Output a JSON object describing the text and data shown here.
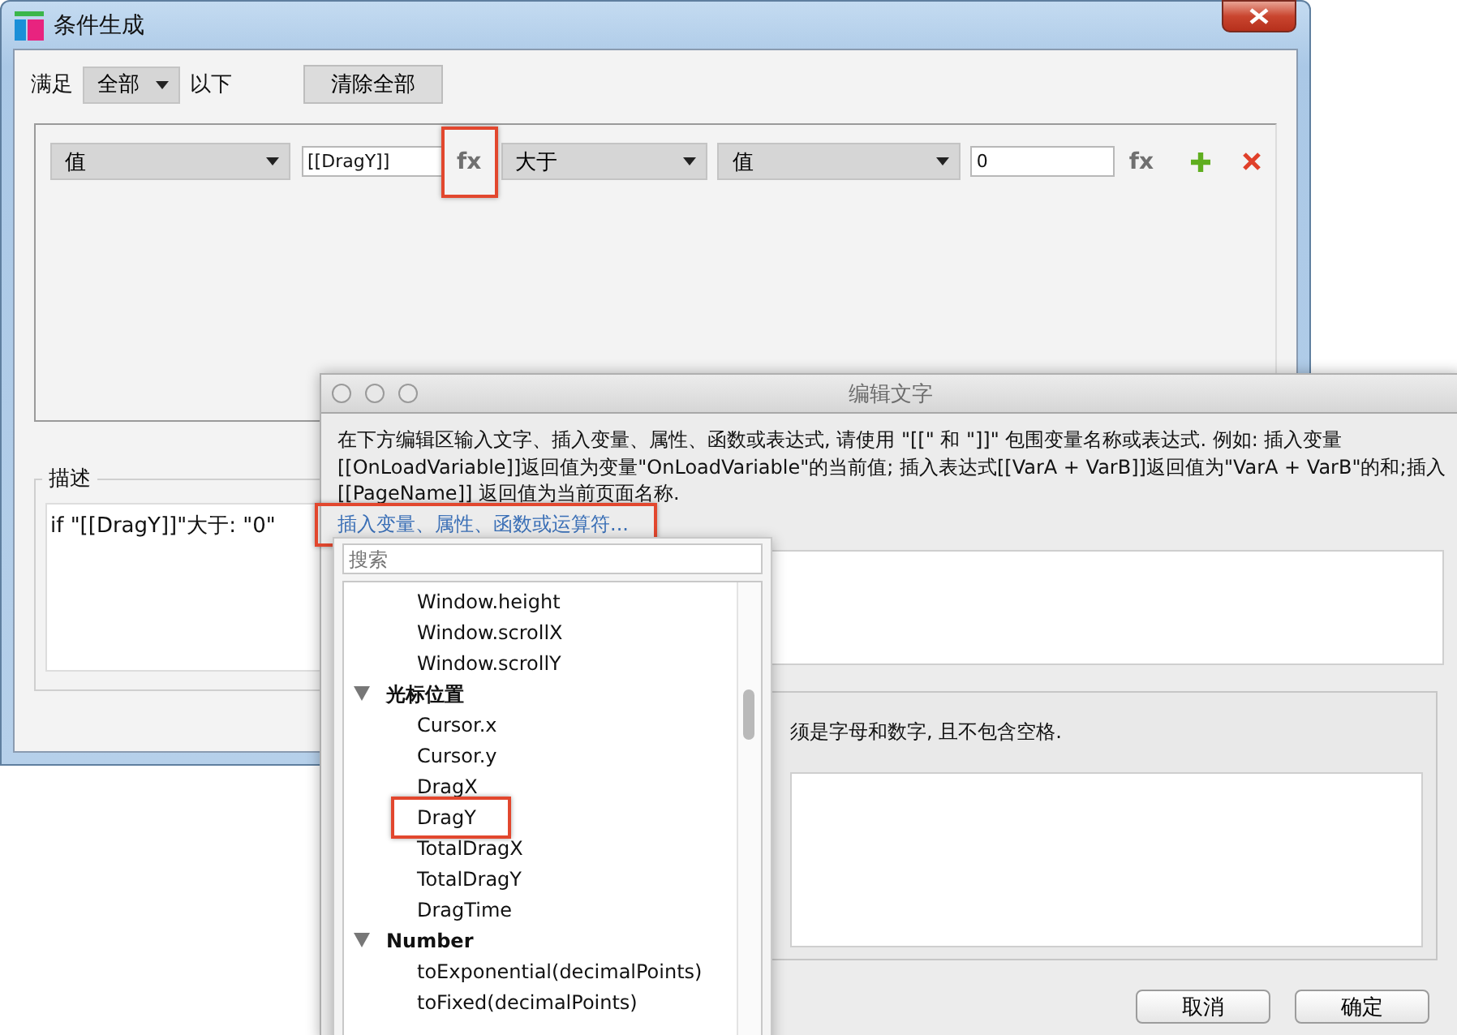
{
  "condition_window": {
    "title": "条件生成",
    "match_label": "满足",
    "match_select": "全部",
    "match_suffix": "以下",
    "clear_button": "清除全部",
    "conditions": [
      {
        "left_type": "值",
        "left_value": "[[DragY]]",
        "left_fx": {
          "label": "fx",
          "highlighted": true
        },
        "operator": "大于",
        "right_type": "值",
        "right_value": "0",
        "right_fx": {
          "label": "fx",
          "highlighted": false
        }
      }
    ],
    "description": {
      "title": "描述",
      "text": "if \"[[DragY]]\"大于: \"0\""
    }
  },
  "edit_window": {
    "title": "编辑文字",
    "instructions": [
      "在下方编辑区输入文字、插入变量、属性、函数或表达式, 请使用 \"[[\" 和 \"]]\" 包围变量名称或表达式. 例如: 插入变量",
      "[[OnLoadVariable]]返回值为变量\"OnLoadVariable\"的当前值; 插入表达式[[VarA + VarB]]返回值为\"VarA + VarB\"的和;插入",
      "[[PageName]] 返回值为当前页面名称."
    ],
    "insert_link": {
      "label": "插入变量、属性、函数或运算符...",
      "highlighted": true
    },
    "group_hint": "须是字母和数字, 且不包含空格.",
    "buttons": [
      {
        "label": "取消"
      },
      {
        "label": "确定"
      }
    ]
  },
  "insert_menu": {
    "search": {
      "placeholder": "搜索"
    },
    "tree": [
      {
        "kind": "leaf",
        "label": "Window.height",
        "highlighted": false
      },
      {
        "kind": "leaf",
        "label": "Window.scrollX",
        "highlighted": false
      },
      {
        "kind": "leaf",
        "label": "Window.scrollY",
        "highlighted": false
      },
      {
        "kind": "group",
        "label": "光标位置",
        "expanded": true,
        "children": [
          {
            "kind": "leaf",
            "label": "Cursor.x",
            "highlighted": false
          },
          {
            "kind": "leaf",
            "label": "Cursor.y",
            "highlighted": false
          },
          {
            "kind": "leaf",
            "label": "DragX",
            "highlighted": false
          },
          {
            "kind": "leaf",
            "label": "DragY",
            "highlighted": true
          },
          {
            "kind": "leaf",
            "label": "TotalDragX",
            "highlighted": false
          },
          {
            "kind": "leaf",
            "label": "TotalDragY",
            "highlighted": false
          },
          {
            "kind": "leaf",
            "label": "DragTime",
            "highlighted": false
          }
        ]
      },
      {
        "kind": "group",
        "label": "Number",
        "expanded": true,
        "children": [
          {
            "kind": "leaf",
            "label": "toExponential(decimalPoints)",
            "highlighted": false
          },
          {
            "kind": "leaf",
            "label": "toFixed(decimalPoints)",
            "highlighted": false
          }
        ]
      }
    ]
  }
}
